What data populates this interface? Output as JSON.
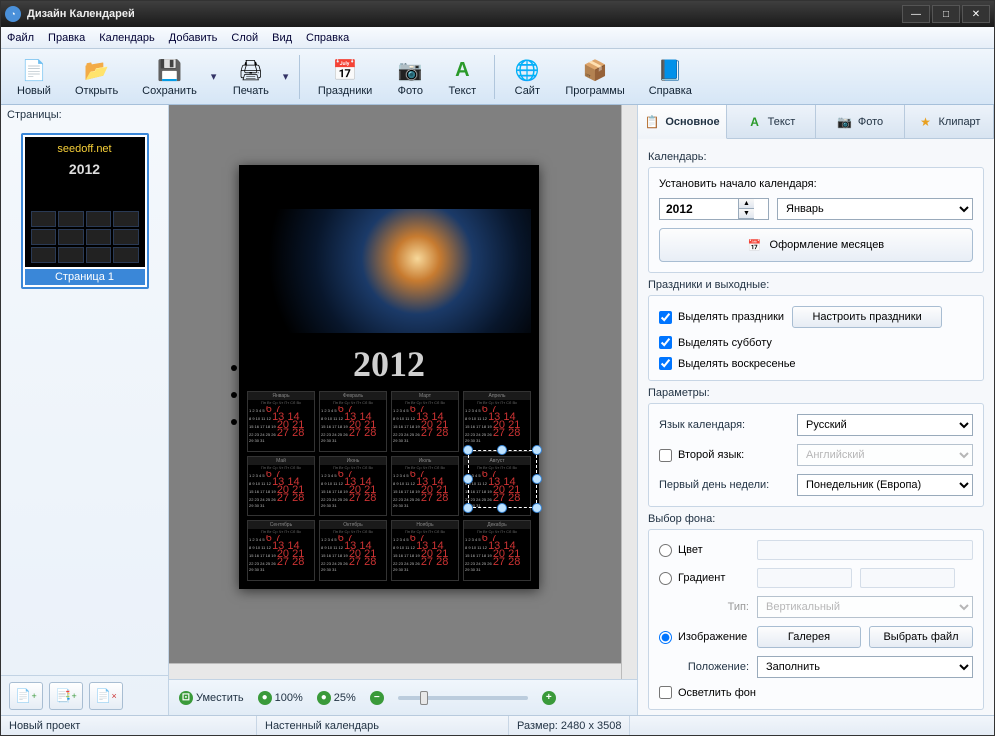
{
  "window": {
    "title": "Дизайн Календарей"
  },
  "menu": [
    "Файл",
    "Правка",
    "Календарь",
    "Добавить",
    "Слой",
    "Вид",
    "Справка"
  ],
  "toolbar": [
    {
      "id": "new",
      "label": "Новый",
      "icon": "📄"
    },
    {
      "id": "open",
      "label": "Открыть",
      "icon": "📂"
    },
    {
      "id": "save",
      "label": "Сохранить",
      "icon": "💾",
      "drop": true
    },
    {
      "id": "print",
      "label": "Печать",
      "icon": "🖨",
      "drop": true
    },
    {
      "sep": true
    },
    {
      "id": "holidays",
      "label": "Праздники",
      "icon": "📅"
    },
    {
      "id": "photo",
      "label": "Фото",
      "icon": "📷"
    },
    {
      "id": "text",
      "label": "Текст",
      "icon": "A",
      "color": "#2a9a2a"
    },
    {
      "sep": true
    },
    {
      "id": "site",
      "label": "Сайт",
      "icon": "⬆"
    },
    {
      "id": "programs",
      "label": "Программы",
      "icon": "📦"
    },
    {
      "id": "help",
      "label": "Справка",
      "icon": "📘"
    }
  ],
  "pages": {
    "header": "Страницы:",
    "items": [
      {
        "caption": "Страница 1",
        "watermark": "seedoff.net",
        "year": "2012"
      }
    ],
    "tools": [
      "add-page",
      "import-page",
      "delete-page"
    ]
  },
  "canvas": {
    "year": "2012",
    "months": [
      "Январь",
      "Февраль",
      "Март",
      "Апрель",
      "Май",
      "Июнь",
      "Июль",
      "Август",
      "Сентябрь",
      "Октябрь",
      "Ноябрь",
      "Декабрь"
    ],
    "dayheader": "Пн Вт Ср Чт Пт Сб Вс",
    "selected_month_index": 7
  },
  "zoom": {
    "fit_label": "Уместить",
    "p100": "100%",
    "p25": "25%"
  },
  "tabs": [
    {
      "id": "main",
      "label": "Основное",
      "icon": "📋"
    },
    {
      "id": "text",
      "label": "Текст",
      "icon": "A"
    },
    {
      "id": "photo",
      "label": "Фото",
      "icon": "📷"
    },
    {
      "id": "clipart",
      "label": "Клипарт",
      "icon": "⭐"
    }
  ],
  "props": {
    "calendar_label": "Календарь:",
    "start_label": "Установить начало календаря:",
    "year_value": "2012",
    "month_value": "Январь",
    "months_design_btn": "Оформление месяцев",
    "holidays_label": "Праздники и выходные:",
    "chk_holidays": "Выделять праздники",
    "btn_holidays": "Настроить праздники",
    "chk_saturday": "Выделять субботу",
    "chk_sunday": "Выделять воскресенье",
    "params_label": "Параметры:",
    "lang_label": "Язык календаря:",
    "lang_value": "Русский",
    "lang2_chk": "Второй язык:",
    "lang2_value": "Английский",
    "firstday_label": "Первый день недели:",
    "firstday_value": "Понедельник (Европа)",
    "bg_label": "Выбор фона:",
    "bg_color": "Цвет",
    "bg_gradient": "Градиент",
    "bg_grad_type_label": "Тип:",
    "bg_grad_type_value": "Вертикальный",
    "bg_image": "Изображение",
    "bg_gallery": "Галерея",
    "bg_choose": "Выбрать файл",
    "bg_pos_label": "Положение:",
    "bg_pos_value": "Заполнить",
    "bg_lighten": "Осветлить фон"
  },
  "status": {
    "project": "Новый проект",
    "type": "Настенный календарь",
    "size": "Размер: 2480 x 3508"
  }
}
